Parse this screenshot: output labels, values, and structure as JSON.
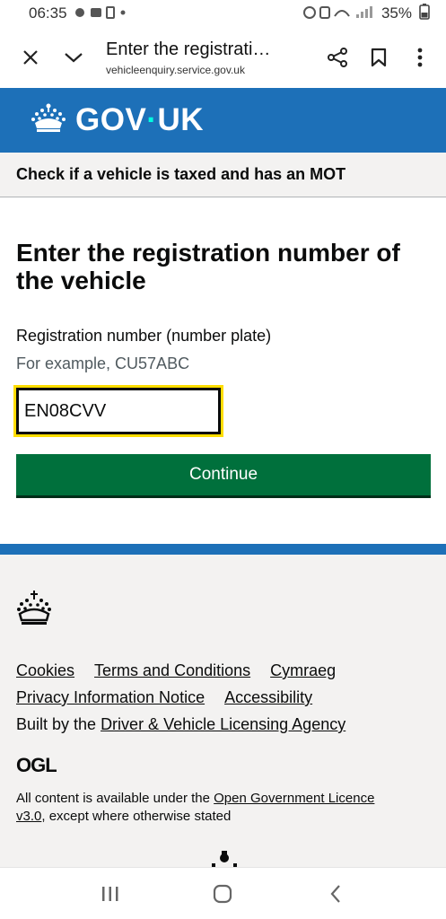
{
  "status_bar": {
    "time": "06:35",
    "battery": "35%"
  },
  "browser": {
    "title": "Enter the registration number of the vehicle",
    "url": "vehicleenquiry.service.gov.uk"
  },
  "header": {
    "logotype_left": "GOV",
    "logotype_dot": "·",
    "logotype_right": "UK",
    "service_name": "Check if a vehicle is taxed and has an MOT"
  },
  "main": {
    "heading": "Enter the registration number of the vehicle",
    "field_label": "Registration number (number plate)",
    "field_hint": "For example, CU57ABC",
    "reg_value": "EN08CVV",
    "continue_label": "Continue"
  },
  "footer": {
    "links_row1": [
      "Cookies",
      "Terms and Conditions",
      "Cymraeg"
    ],
    "links_row2": [
      "Privacy Information Notice",
      "Accessibility"
    ],
    "built_by_prefix": "Built by the ",
    "built_by_link": "Driver & Vehicle Licensing Agency",
    "ogl_label": "OGL",
    "licence_prefix": "All content is available under the ",
    "licence_link": "Open Government Licence v3.0",
    "licence_suffix": ", except where otherwise stated"
  },
  "colors": {
    "gov_blue": "#1d70b8",
    "button_green": "#00703c",
    "focus_yellow": "#ffdd00",
    "footer_bg": "#f3f2f1"
  }
}
